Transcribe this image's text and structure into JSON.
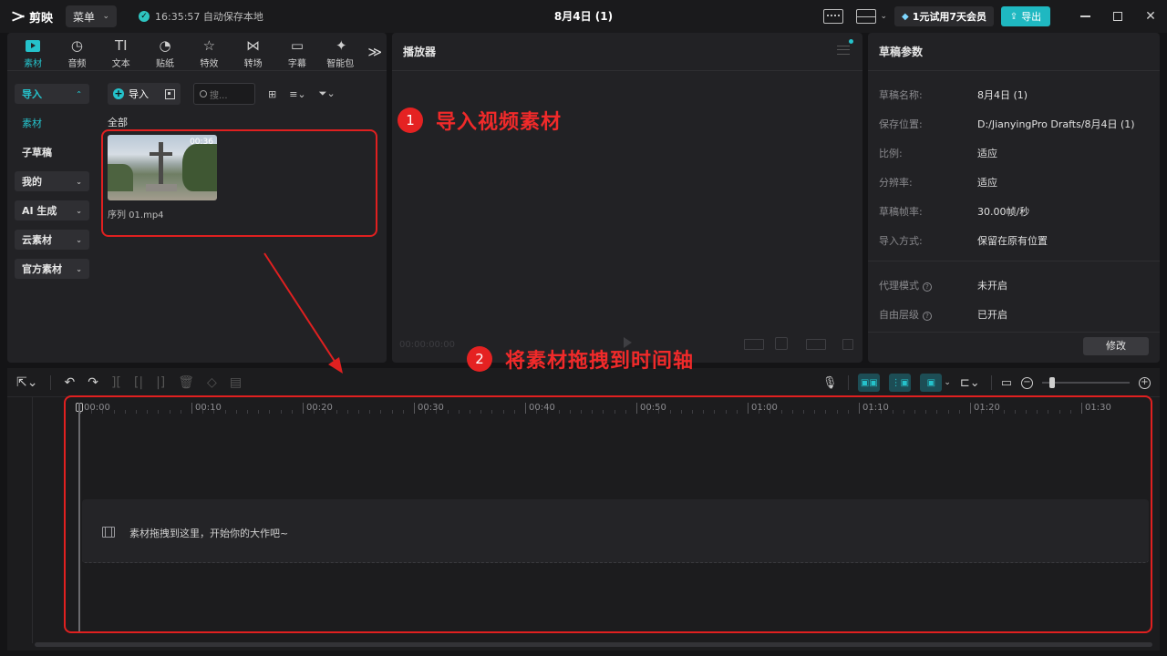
{
  "app": {
    "name": "剪映",
    "menu_label": "菜单",
    "autosave_text": "16:35:57 自动保存本地",
    "window_title": "8月4日 (1)",
    "vip_label": "1元试用7天会员",
    "export_label": "导出"
  },
  "media": {
    "tabs": [
      {
        "label": "素材",
        "icon": "media-icon",
        "glyph": ""
      },
      {
        "label": "音频",
        "icon": "audio-icon",
        "glyph": "◷"
      },
      {
        "label": "文本",
        "icon": "text-icon",
        "glyph": "TI"
      },
      {
        "label": "贴纸",
        "icon": "sticker-icon",
        "glyph": "◔"
      },
      {
        "label": "特效",
        "icon": "effects-icon",
        "glyph": "☆"
      },
      {
        "label": "转场",
        "icon": "transition-icon",
        "glyph": "⋈"
      },
      {
        "label": "字幕",
        "icon": "caption-icon",
        "glyph": "▭"
      },
      {
        "label": "智能包",
        "icon": "smart-icon",
        "glyph": "✦"
      }
    ],
    "more_glyph": "≫",
    "side": [
      {
        "label": "导入",
        "state": "active",
        "chev": "⌃"
      },
      {
        "label": "素材",
        "state": "teal",
        "chev": ""
      },
      {
        "label": "子草稿",
        "state": "plain",
        "chev": ""
      },
      {
        "label": "我的",
        "state": "boxed",
        "chev": "⌄"
      },
      {
        "label": "AI 生成",
        "state": "boxed",
        "chev": "⌄"
      },
      {
        "label": "云素材",
        "state": "boxed",
        "chev": "⌄"
      },
      {
        "label": "官方素材",
        "state": "boxed",
        "chev": "⌄"
      }
    ],
    "import_label": "导入",
    "search_placeholder": "搜...",
    "all_label": "全部",
    "clip": {
      "name": "序列 01.mp4",
      "duration": "00:36"
    }
  },
  "annotations": {
    "step1_num": "1",
    "step1_text": "导入视频素材",
    "step2_num": "2",
    "step2_text": "将素材拖拽到时间轴"
  },
  "player": {
    "title": "播放器",
    "timecode": "00:00:00:00"
  },
  "draft": {
    "title": "草稿参数",
    "rows": [
      {
        "key": "草稿名称:",
        "value": "8月4日 (1)",
        "info": false
      },
      {
        "key": "保存位置:",
        "value": "D:/JianyingPro Drafts/8月4日 (1)",
        "info": false
      },
      {
        "key": "比例:",
        "value": "适应",
        "info": false
      },
      {
        "key": "分辨率:",
        "value": "适应",
        "info": false
      },
      {
        "key": "草稿帧率:",
        "value": "30.00帧/秒",
        "info": false
      },
      {
        "key": "导入方式:",
        "value": "保留在原有位置",
        "info": false
      },
      {
        "key": "代理模式",
        "value": "未开启",
        "info": true
      },
      {
        "key": "自由层级",
        "value": "已开启",
        "info": true
      }
    ],
    "edit_label": "修改"
  },
  "timeline": {
    "ticks": [
      "00:00",
      "00:10",
      "00:20",
      "00:30",
      "00:40",
      "00:50",
      "01:00",
      "01:10",
      "01:20",
      "01:30"
    ],
    "drop_hint": "素材拖拽到这里，开始你的大作吧~"
  },
  "colors": {
    "accent": "#25c2cb",
    "annotation_red": "#e02020"
  }
}
